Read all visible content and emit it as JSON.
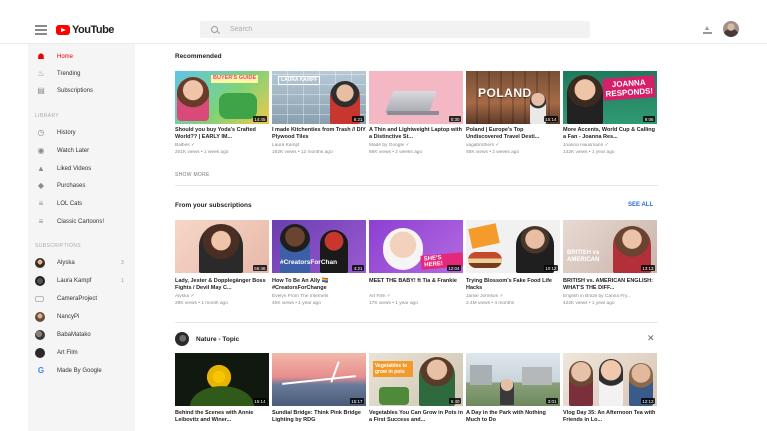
{
  "header": {
    "logo_text": "YouTube",
    "search_placeholder": "Search"
  },
  "sidebar": {
    "main": [
      {
        "label": "Home",
        "icon": "home-icon"
      },
      {
        "label": "Trending",
        "icon": "flame-icon"
      },
      {
        "label": "Subscriptions",
        "icon": "subscriptions-icon"
      }
    ],
    "library_heading": "LIBRARY",
    "library": [
      {
        "label": "History",
        "icon": "history-icon"
      },
      {
        "label": "Watch Later",
        "icon": "clock-icon"
      },
      {
        "label": "Liked Videos",
        "icon": "thumbs-up-icon"
      },
      {
        "label": "Purchases",
        "icon": "tag-icon"
      },
      {
        "label": "LOL Cats",
        "icon": "playlist-icon"
      },
      {
        "label": "Classic Cartoons!",
        "icon": "playlist-icon"
      }
    ],
    "subscriptions_heading": "SUBSCRIPTIONS",
    "subscriptions": [
      {
        "label": "Alyska",
        "count": "3"
      },
      {
        "label": "Laura Kampf",
        "count": "1"
      },
      {
        "label": "CameraProject",
        "count": ""
      },
      {
        "label": "NancyPi",
        "count": ""
      },
      {
        "label": "BabaMatako",
        "count": ""
      },
      {
        "label": "Art Film",
        "count": ""
      },
      {
        "label": "Made By Google",
        "count": ""
      }
    ]
  },
  "recommended": {
    "title": "Recommended",
    "show_more": "SHOW MORE",
    "videos": [
      {
        "title": "Should you buy Yoda's Crafted World?? | EARLY IM...",
        "channel": "Balbes ✓",
        "meta": "201K views • 1 week ago",
        "duration": "14:45",
        "thumb_text": "BUYER'S GUIDE"
      },
      {
        "title": "I made Kitchenties from Trash // DIY Plywood Tiles",
        "channel": "Laura Kampf",
        "meta": "162K views • 12 months ago",
        "duration": "6:21",
        "thumb_text": "LAURA KAMPF"
      },
      {
        "title": "A Thin and Lightweight Laptop with a Distinctive St...",
        "channel": "Made by Google ✓",
        "meta": "66K views • 2 weeks ago",
        "duration": "0:30",
        "thumb_text": ""
      },
      {
        "title": "Poland | Europe's Top Undiscovered Travel Desti...",
        "channel": "vagabrothers ✓",
        "meta": "56K views • 2 weeks ago",
        "duration": "15:14",
        "thumb_text": "POLAND"
      },
      {
        "title": "More Accents, World Cup & Calling a Fan - Joanna Res...",
        "channel": "Joanna Hausmann ✓",
        "meta": "142K views • 1 year ago",
        "duration": "9:06",
        "thumb_text": "JOANNA RESPONDS!"
      }
    ]
  },
  "subscriptions_section": {
    "title": "From your subscriptions",
    "see_all": "SEE ALL",
    "videos": [
      {
        "title": "Lady, Jester & Dopplegänger Boss Fights / Devil May C...",
        "channel": "Alyska ✓",
        "meta": "28K views • 1 month ago",
        "duration": "56:46",
        "thumb_text": ""
      },
      {
        "title": "How To Be An Ally 🏳️‍🌈 #CreatorsForChange",
        "channel": "Evelyn From The Internets",
        "meta": "40K views • 1 year ago",
        "duration": "4:21",
        "thumb_text": "#CreatorsForChan"
      },
      {
        "title": "MEET THE BABY! ft Tia & Frankie",
        "channel": "Art Film ✓",
        "meta": "17K views • 1 year ago",
        "duration": "12:04",
        "thumb_text": "SHE'S HERE!"
      },
      {
        "title": "Trying Blossom's Fake Food Life Hacks",
        "channel": "Jamie Johnson ✓",
        "meta": "2.4M views • 4 months",
        "duration": "10:12",
        "thumb_text": ""
      },
      {
        "title": "BRITISH vs. AMERICAN ENGLISH: WHAT'S THE DIFF...",
        "channel": "English in Brazil by Carina Fry...",
        "meta": "422K views • 1 year ago",
        "duration": "13:13",
        "thumb_text": "BRITISH vs AMERICAN"
      }
    ]
  },
  "topic": {
    "title": "Nature - Topic",
    "videos": [
      {
        "title": "Behind the Scenes with Annie Leibovitz and Winer...",
        "duration": "15:14",
        "thumb_text": ""
      },
      {
        "title": "Sundial Bridge: Think Pink Bridge Lighting by RDG",
        "duration": "15:17",
        "thumb_text": ""
      },
      {
        "title": "Vegetables You Can Grow in Pots in a First Success and...",
        "duration": "6:40",
        "thumb_text": "Vegetables to grow in pots"
      },
      {
        "title": "A Day in the Park with Nothing Much to Do",
        "duration": "3:01",
        "thumb_text": ""
      },
      {
        "title": "Vlog Day 35: An Afternoon Tea with Friends in Lo...",
        "duration": "12:12",
        "thumb_text": ""
      }
    ]
  },
  "colors": {
    "brand_red": "#ff0000",
    "link_blue": "#2a6fd0",
    "sidebar_bg": "#f5f5f5"
  }
}
